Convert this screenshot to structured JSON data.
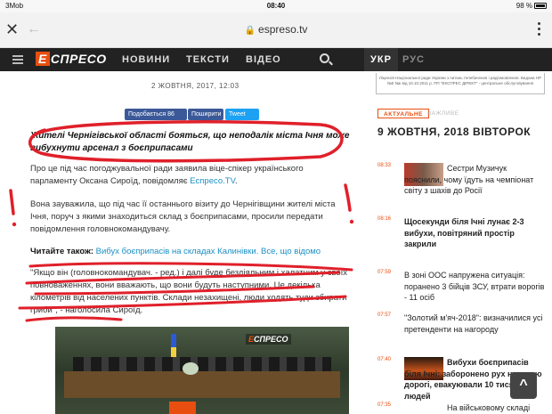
{
  "status": {
    "carrier": "3Mob",
    "time": "08:40",
    "battery": "98 %"
  },
  "browser": {
    "url": "espreso.tv"
  },
  "site": {
    "logo_mark": "Е",
    "logo_text": "СПРЕСО",
    "nav": [
      "НОВИНИ",
      "ТЕКСТИ",
      "ВІДЕО"
    ],
    "lang_active": "УКР",
    "lang_other": "РУС"
  },
  "article": {
    "date": "2 ЖОВТНЯ, 2017, 12:03",
    "share": {
      "fb": "Подобається 86",
      "fb2": "Поширити",
      "tw": "Tweet"
    },
    "lead": "Жителі Чернігівської області бояться, що неподалік міста Ічня може вибухнути арсенал з боєприпасами",
    "p1_text": "Про це під час погоджувальної ради заявила віце-спікер українського парламенту Оксана Сироїд, повідомляє ",
    "p1_link": "Еспресо.TV",
    "p1_end": ".",
    "p2": "Вона зауважила, що під час її останнього візиту до Чернігівщини жителі міста Ічня, поруч з якими знаходиться склад з боєприпасами, просили передати повідомлення головнокомандувачу.",
    "readalso_label": "Читайте також:",
    "readalso_link": " Вибух боєприпасів на складах Калинівки. Все, що відомо",
    "quote": "\"Якщо він (головнокомандувач. - ред.) і далі буде бездіяльним і халатним у своїх повноваженнях, вони вважають, що вони будуть наступними. Це декілька кілометрів від населених пунктів. Склади незахищені, люди ходять туди збирати гриби\", - наголосила Сироїд.",
    "video_logo_e": "Е",
    "video_logo": "СПРЕСО"
  },
  "sidebar": {
    "ad": "Ліцензія Національної ради України з питань телебачення і радіомовлення. Видана НР №5 №к від 10.10.2011 р. ПП \"ЕКСПРЕС ДІРЕКТ\" - центральне обслуговування",
    "tab_active": "АКТУАЛЬНЕ",
    "tab_inactive": "ВАЖЛИВЕ",
    "date": "9 ЖОВТНЯ, 2018 ВІВТОРОК",
    "news": [
      {
        "time": "08:33",
        "title": "Сестри Музичук пояснили, чому їдуть на чемпіонат світу з шахів до Росії",
        "bold": false
      },
      {
        "time": "08:16",
        "title": "Щосекунди біля Ічні лунає 2-3 вибухи, повітряний простір закрили",
        "bold": true
      },
      {
        "time": "07:59",
        "title": "В зоні ООС напружена ситуація: поранено 3 бійців ЗСУ, втрати ворогів - 11 осіб",
        "bold": false
      },
      {
        "time": "07:57",
        "title": "\"Золотий м'яч-2018\": визначилися усі претенденти на нагороду",
        "bold": false
      },
      {
        "time": "07:40",
        "title": "Вибухи боєприпасів біля Ічні: заборонено рух низькою дорогі, евакуювали 10 тисяч людей",
        "bold": true
      },
      {
        "time": "07:35",
        "title": "На військовому складі",
        "bold": false
      }
    ]
  }
}
